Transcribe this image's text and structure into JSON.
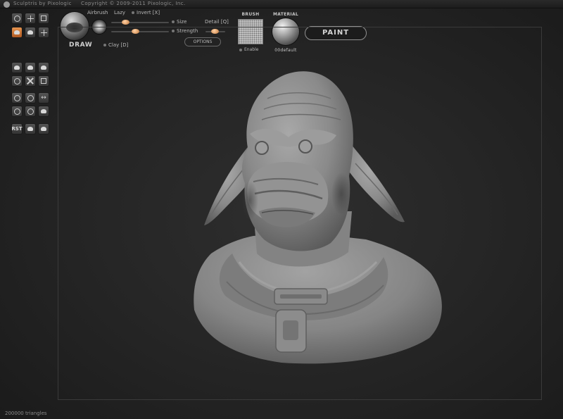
{
  "window": {
    "title": "Sculptris by Pixologic",
    "copyright": "Copyright © 2009-2011 Pixologic, Inc."
  },
  "brush": {
    "name": "DRAW",
    "airbrush_label": "Airbrush",
    "lazy_label": "Lazy",
    "invert_label": "Invert [X]",
    "size_label": "Size",
    "detail_label": "Detail [Q]",
    "strength_label": "Strength",
    "clay_label": "Clay [D]",
    "options_label": "OPTIONS",
    "size_value": 0.18,
    "strength_value": 0.35
  },
  "stroke": {
    "heading": "BRUSH",
    "enable_label": "Enable"
  },
  "material": {
    "heading": "MATERIAL",
    "name": "00default"
  },
  "paint_button": "PAINT",
  "tools": {
    "active_index": 3,
    "reset_label": "RST",
    "icons": [
      "grab-icon",
      "rotate-icon",
      "crease-icon",
      "draw-icon",
      "inflate-icon",
      "pinch-icon",
      "flatten-icon",
      "smooth-icon",
      "scale-icon",
      "symmetry-icon",
      "wireframe-icon",
      "grid-icon",
      "reduce-brush-icon",
      "subdivide-icon",
      "mirror-icon",
      "import-icon",
      "export-icon",
      "new-sphere-icon",
      "plane-icon",
      "mask-icon",
      "hide-icon"
    ]
  },
  "status": {
    "triangles": "200000 triangles"
  },
  "colors": {
    "accent": "#d2732e",
    "background": "#262626",
    "model": "#8f8f8f"
  }
}
